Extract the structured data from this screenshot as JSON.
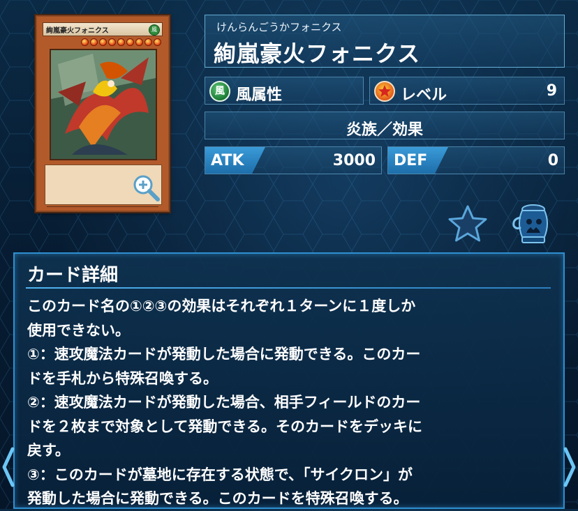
{
  "card": {
    "thumbnail_name": "絢嵐豪火フォニクス",
    "thumbnail_attr": "風",
    "stars": 9
  },
  "header": {
    "reading": "けんらんごうかフォニクス",
    "name": "絢嵐豪火フォニクス"
  },
  "attribute": {
    "icon": "wind-attribute-icon",
    "icon_char": "風",
    "label": "風属性"
  },
  "level": {
    "icon": "level-star-icon",
    "label": "レベル",
    "value": "9"
  },
  "type": {
    "label": "炎族／効果"
  },
  "atk": {
    "label": "ATK",
    "value": "3000"
  },
  "def": {
    "label": "DEF",
    "value": "0"
  },
  "actions": {
    "favorite_icon": "star-icon",
    "deck_icon": "pot-icon"
  },
  "detail": {
    "title": "カード詳細",
    "lines": [
      "このカード名の①②③の効果はそれぞれ１ターンに１度しか",
      "使用できない。",
      "①：速攻魔法カードが発動した場合に発動できる。このカー",
      "ドを手札から特殊召喚する。",
      "②：速攻魔法カードが発動した場合、相手フィールドのカー",
      "ドを２枚まで対象として発動できる。そのカードをデッキに",
      "戻す。",
      "③：このカードが墓地に存在する状態で、「サイクロン」が",
      "発動した場合に発動できる。このカードを特殊召喚する。"
    ]
  },
  "colors": {
    "accent": "#2e8fd0",
    "stat_tag": "#3a9bd8",
    "wind_green": "#1a7a34"
  }
}
